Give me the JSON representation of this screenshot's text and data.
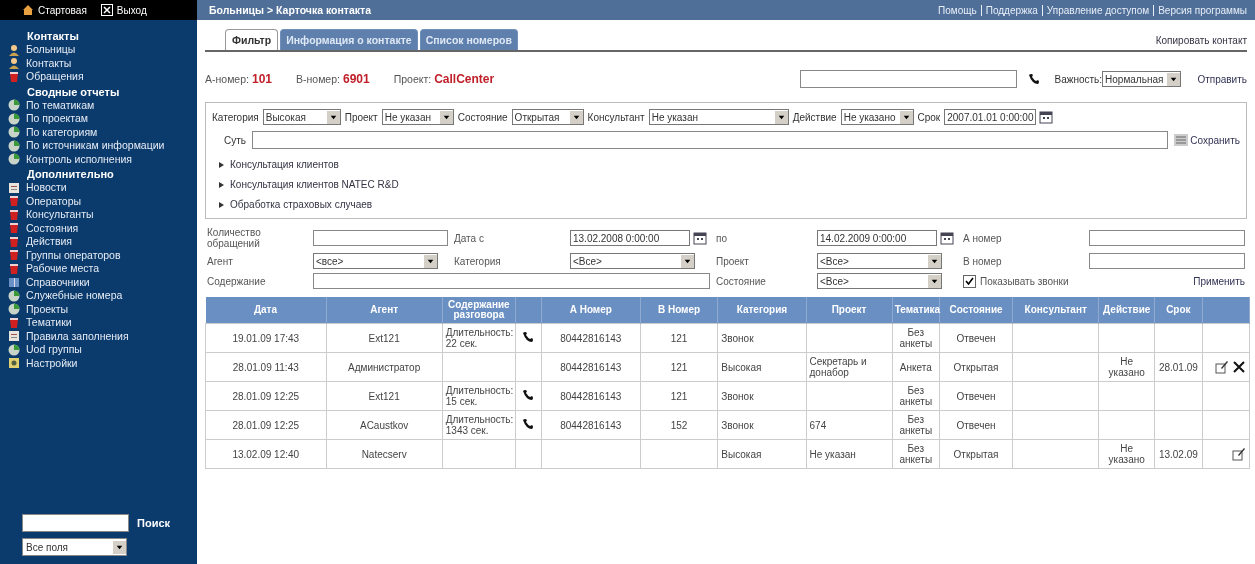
{
  "sidebar": {
    "top_links": [
      {
        "label": "Стартовая",
        "kind": "home"
      },
      {
        "label": "Выход",
        "kind": "exit"
      }
    ],
    "sections": [
      {
        "title": "Контакты",
        "items": [
          {
            "label": "Больницы",
            "kind": "person"
          },
          {
            "label": "Контакты",
            "kind": "person"
          },
          {
            "label": "Обращения",
            "kind": "cup"
          }
        ]
      },
      {
        "title": "Сводные отчеты",
        "items": [
          {
            "label": "По тематикам",
            "kind": "disc"
          },
          {
            "label": "По проектам",
            "kind": "disc"
          },
          {
            "label": "По категориям",
            "kind": "disc"
          },
          {
            "label": "По источникам информации",
            "kind": "disc"
          },
          {
            "label": "Контроль исполнения",
            "kind": "disc"
          }
        ]
      },
      {
        "title": "Дополнительно",
        "items": [
          {
            "label": "Новости",
            "kind": "document"
          },
          {
            "label": "Операторы",
            "kind": "cup"
          },
          {
            "label": "Консультанты",
            "kind": "cup"
          },
          {
            "label": "Состояния",
            "kind": "cup"
          },
          {
            "label": "Действия",
            "kind": "cup"
          },
          {
            "label": "Группы операторов",
            "kind": "cup"
          },
          {
            "label": "Рабочие места",
            "kind": "cup"
          },
          {
            "label": "Справочники",
            "kind": "book"
          },
          {
            "label": "Служебные номера",
            "kind": "disc"
          },
          {
            "label": "Проекты",
            "kind": "disc"
          },
          {
            "label": "Тематики",
            "kind": "cup"
          },
          {
            "label": "Правила заполнения",
            "kind": "document"
          },
          {
            "label": "Uod группы",
            "kind": "disc"
          },
          {
            "label": "Настройки",
            "kind": "settings"
          }
        ]
      }
    ],
    "search": {
      "button": "Поиск",
      "scope": "Все поля"
    }
  },
  "header": {
    "breadcrumb": "Больницы > Карточка контакта",
    "links": [
      "Помощь",
      "Поддержка",
      "Управление доступом",
      "Версия программы"
    ]
  },
  "tabs": [
    {
      "label": "Фильтр",
      "selected": true
    },
    {
      "label": "Информация о контакте",
      "selected": false
    },
    {
      "label": "Список номеров",
      "selected": false
    }
  ],
  "copy_link": "Копировать контакт",
  "info": {
    "pairs": [
      {
        "label": "А-номер:",
        "value": "101"
      },
      {
        "label": "В-номер:",
        "value": "6901"
      },
      {
        "label": "Проект:",
        "value": "CallCenter"
      }
    ],
    "importance_label": "Важность:",
    "importance": "Нормальная",
    "send": "Отправить"
  },
  "filter_box": {
    "fields": [
      {
        "label": "Категория",
        "value": "Высокая",
        "kind": "select"
      },
      {
        "label": "Проект",
        "value": "Не указан",
        "kind": "select"
      },
      {
        "label": "Состояние",
        "value": "Открытая",
        "kind": "select"
      },
      {
        "label": "Консультант",
        "value": "Не указан",
        "kind": "select"
      },
      {
        "label": "Действие",
        "value": "Не указано",
        "kind": "select"
      },
      {
        "label": "Срок",
        "value": "2007.01.01 0:00:00",
        "kind": "date"
      }
    ],
    "essence_label": "Суть",
    "save": "Сохранить",
    "tree": [
      {
        "label": "Консультация клиентов",
        "expanded": false
      },
      {
        "label": "Консультация клиентов NATEC R&D",
        "expanded": false
      },
      {
        "label": "Обработка страховых случаев",
        "expanded": false
      }
    ]
  },
  "search_form": {
    "rows": [
      [
        {
          "kind": "label",
          "text": "Количество обращений"
        },
        {
          "kind": "input"
        },
        {
          "kind": "label",
          "text": "Дата с"
        },
        {
          "kind": "date",
          "value": "13.02.2008 0:00:00"
        },
        {
          "kind": "label",
          "text": "по"
        },
        {
          "kind": "date",
          "value": "14.02.2009 0:00:00"
        },
        {
          "kind": "label",
          "text": "А номер"
        },
        {
          "kind": "input"
        }
      ],
      [
        {
          "kind": "label",
          "text": "Агент"
        },
        {
          "kind": "select",
          "value": "<все>"
        },
        {
          "kind": "label",
          "text": "Категория"
        },
        {
          "kind": "select",
          "value": "<Все>"
        },
        {
          "kind": "label",
          "text": "Проект"
        },
        {
          "kind": "select",
          "value": "<Все>"
        },
        {
          "kind": "label",
          "text": "В номер"
        },
        {
          "kind": "input"
        }
      ],
      [
        {
          "kind": "label",
          "text": "Содержание"
        },
        {
          "kind": "input"
        },
        "",
        "",
        {
          "kind": "label",
          "text": "Состояние"
        },
        {
          "kind": "select",
          "value": "<Все>"
        },
        {
          "kind": "checkbox",
          "text": "Показывать звонки",
          "checked": true
        },
        {
          "kind": "link",
          "text": "Применить"
        }
      ]
    ]
  },
  "table": {
    "columns": [
      "Дата",
      "Агент",
      "Содержание разговора",
      "А Номер",
      "В Номер",
      "Категория",
      "Проект",
      "Тематика",
      "Состояние",
      "Консультант",
      "Действие",
      "Срок"
    ],
    "rows": [
      {
        "cells": [
          "19.01.09 17:43",
          "Ext121",
          "Длительность: 22 сек.",
          "80442816143",
          "121",
          "Звонок",
          null,
          "Без анкеты",
          "Отвечен",
          null,
          null,
          null
        ],
        "call": true,
        "edit": false,
        "delete": false
      },
      {
        "cells": [
          "28.01.09 11:43",
          "Администратор",
          null,
          "80442816143",
          "121",
          "Высокая",
          "Секретарь и донабор",
          "Анкета",
          "Открытая",
          null,
          "Не указано",
          "28.01.09"
        ],
        "call": false,
        "edit": true,
        "delete": true
      },
      {
        "cells": [
          "28.01.09 12:25",
          "Ext121",
          "Длительность: 15 сек.",
          "80442816143",
          "121",
          "Звонок",
          null,
          "Без анкеты",
          "Отвечен",
          null,
          null,
          null
        ],
        "call": true,
        "edit": false,
        "delete": false
      },
      {
        "cells": [
          "28.01.09 12:25",
          "ACaustkov",
          "Длительность: 1343 сек.",
          "80442816143",
          "152",
          "Звонок",
          "674",
          "Без анкеты",
          "Отвечен",
          null,
          null,
          null
        ],
        "call": true,
        "edit": false,
        "delete": false
      },
      {
        "cells": [
          "13.02.09 12:40",
          "Natecserv",
          null,
          null,
          null,
          "Высокая",
          "Не указан",
          "Без анкеты",
          "Открытая",
          null,
          "Не указано",
          "13.02.09"
        ],
        "call": false,
        "edit": true,
        "delete": false
      }
    ]
  }
}
